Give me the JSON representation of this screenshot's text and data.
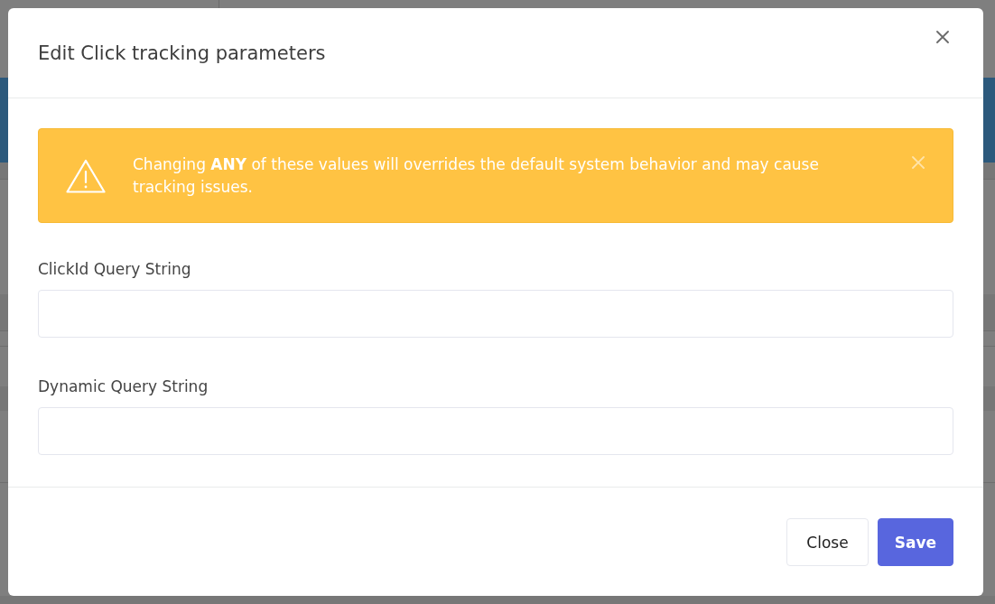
{
  "modal": {
    "title": "Edit Click tracking parameters",
    "alert": {
      "kind": "warning",
      "text": "Changing **ANY** of these values will overrides the default system behavior and may cause tracking issues.",
      "dismissible": true
    },
    "fields": [
      {
        "label": "ClickId Query String"
      },
      {
        "label": "Dynamic Query String"
      }
    ],
    "buttons": [
      {
        "label": "Close",
        "kind": "secondary"
      },
      {
        "label": "Save",
        "kind": "primary"
      }
    ]
  }
}
